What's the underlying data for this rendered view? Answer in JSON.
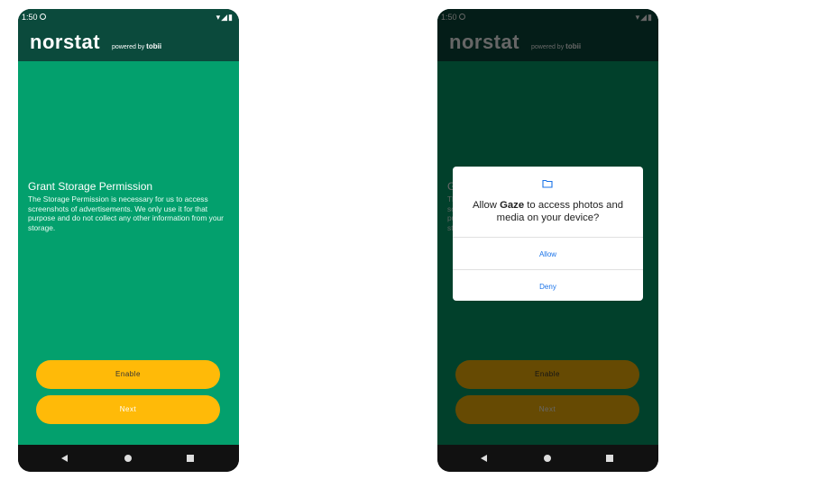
{
  "status_bar": {
    "time": "1:50",
    "icons": "▾◢▮"
  },
  "brand": {
    "name": "norstat",
    "powered_prefix": "powered by",
    "powered_brand": "tobii"
  },
  "permission": {
    "title": "Grant Storage Permission",
    "body": "The Storage Permission is necessary for us to access screenshots of advertisements. We only use it for that purpose and do not collect any other information from your storage."
  },
  "buttons": {
    "enable": "Enable",
    "next": "Next"
  },
  "dialog": {
    "prefix": "Allow",
    "app_name": "Gaze",
    "suffix": "to access photos and media on your device?",
    "allow": "Allow",
    "deny": "Deny"
  },
  "colors": {
    "header": "#0b4a3c",
    "content": "#03a06d",
    "button": "#ffba08",
    "dialog_action": "#1a73e8"
  }
}
